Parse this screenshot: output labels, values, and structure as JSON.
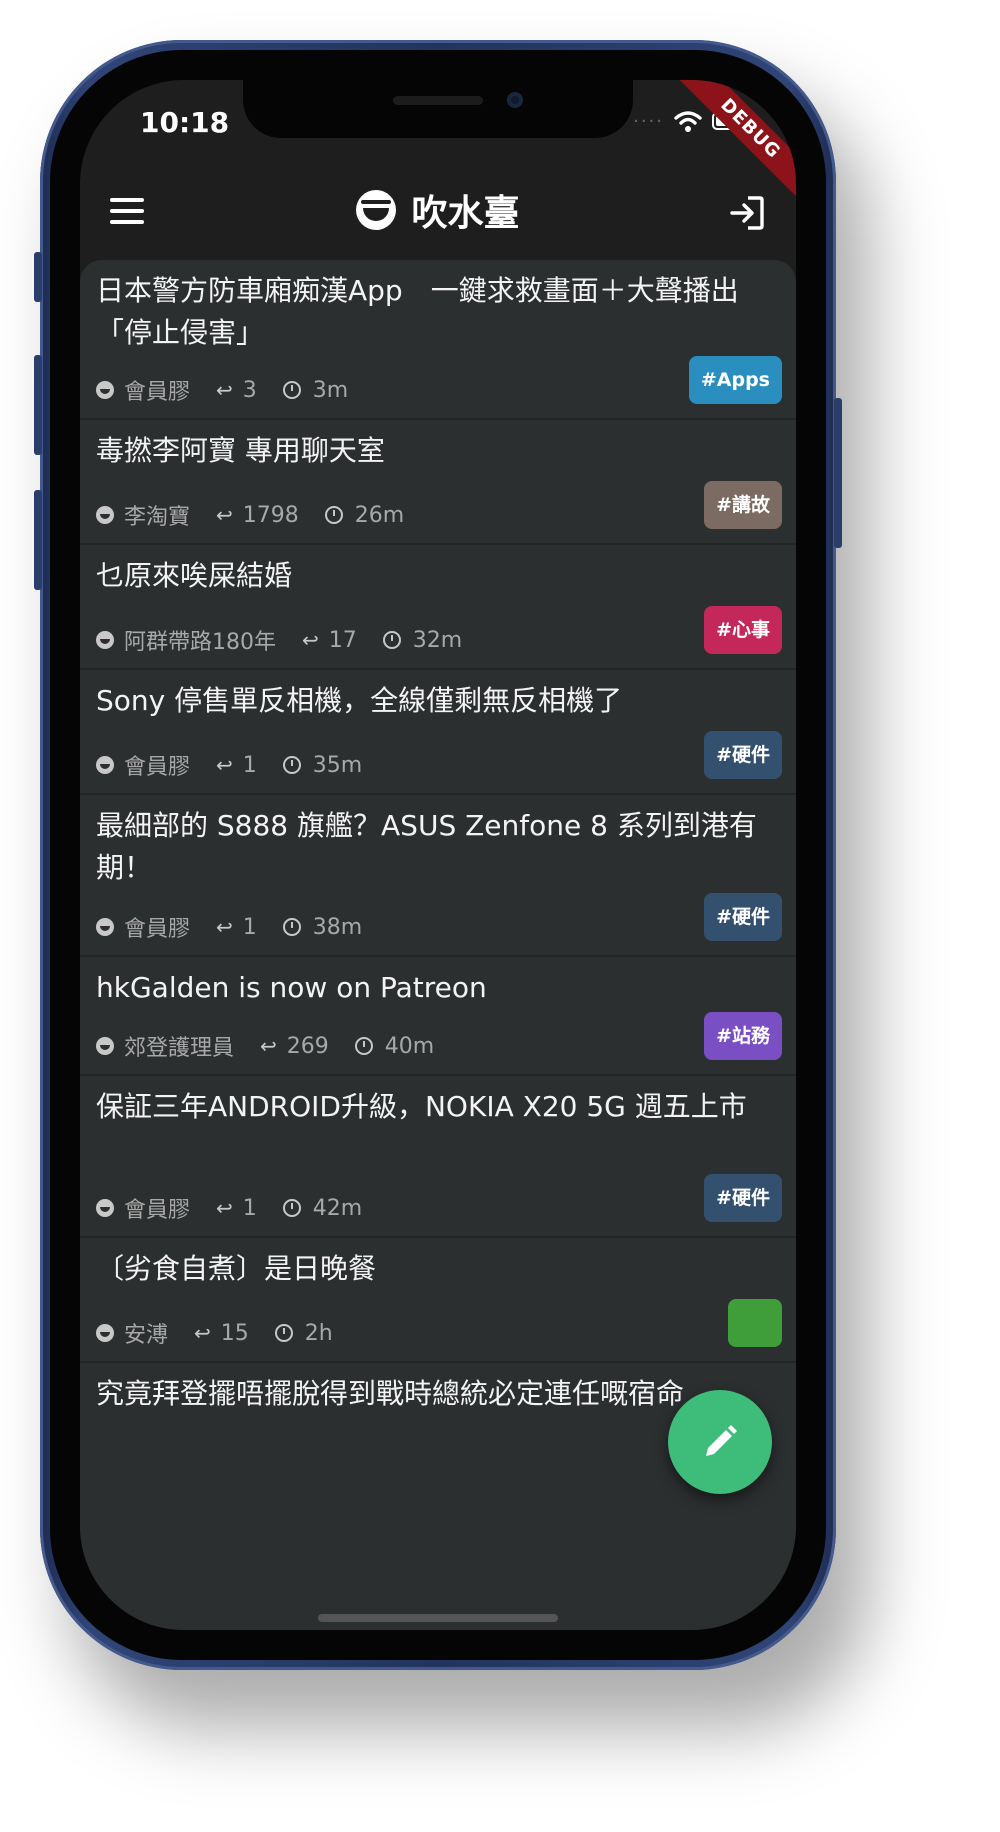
{
  "status_bar": {
    "time": "10:18",
    "debug_label": "DEBUG"
  },
  "app_bar": {
    "title": "吹水臺"
  },
  "threads": [
    {
      "title": "日本警方防車廂痴漢App　一鍵求救畫面＋大聲播出「停止侵害」",
      "author": "會員膠",
      "replies": "3",
      "time": "3m",
      "tag": "#Apps",
      "tag_color": "#2a8fbf"
    },
    {
      "title": "毒撚李阿寶 專用聊天室",
      "author": "李淘寶",
      "replies": "1798",
      "time": "26m",
      "tag": "#講故",
      "tag_color": "#7c6b62"
    },
    {
      "title": "乜原來唉屎結婚",
      "author": "阿群帶路180年",
      "replies": "17",
      "time": "32m",
      "tag": "#心事",
      "tag_color": "#c4285a"
    },
    {
      "title": "Sony 停售單反相機，全線僅剩無反相機了",
      "author": "會員膠",
      "replies": "1",
      "time": "35m",
      "tag": "#硬件",
      "tag_color": "#34506f"
    },
    {
      "title": "最細部的 S888 旗艦？ASUS Zenfone 8 系列到港有期！",
      "author": "會員膠",
      "replies": "1",
      "time": "38m",
      "tag": "#硬件",
      "tag_color": "#34506f"
    },
    {
      "title": "hkGalden is now on Patreon",
      "author": "郊登護理員",
      "replies": "269",
      "time": "40m",
      "tag": "#站務",
      "tag_color": "#7a4fc4"
    },
    {
      "title": "保証三年ANDROID升級，NOKIA X20 5G 週五上市",
      "author": "會員膠",
      "replies": "1",
      "time": "42m",
      "tag": "#硬件",
      "tag_color": "#34506f"
    },
    {
      "title": "〔劣食自煮〕是日晚餐",
      "author": "安溥",
      "replies": "15",
      "time": "2h",
      "tag": "",
      "tag_color": "#3f9e3a"
    },
    {
      "title": "究竟拜登擺唔擺脫得到戰時總統必定連任嘅宿命",
      "author": "",
      "replies": "",
      "time": "",
      "tag": "",
      "tag_color": ""
    }
  ]
}
